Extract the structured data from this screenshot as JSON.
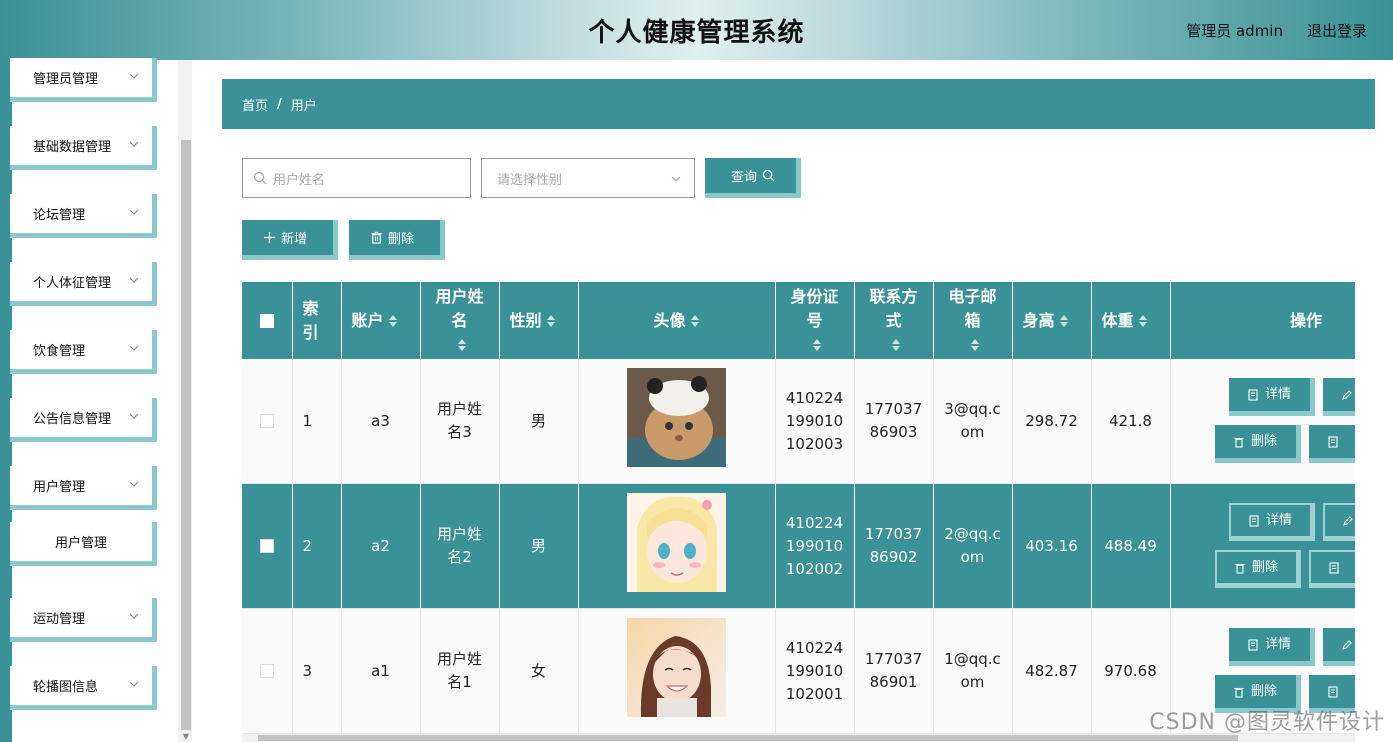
{
  "header": {
    "title": "个人健康管理系统",
    "user": "管理员 admin",
    "logout": "退出登录"
  },
  "sidebar": {
    "items": [
      {
        "label": "管理员管理"
      },
      {
        "label": "基础数据管理"
      },
      {
        "label": "论坛管理"
      },
      {
        "label": "个人体征管理"
      },
      {
        "label": "饮食管理"
      },
      {
        "label": "公告信息管理"
      },
      {
        "label": "用户管理"
      },
      {
        "label": "运动管理"
      },
      {
        "label": "轮播图信息"
      }
    ],
    "active_sub": "用户管理"
  },
  "breadcrumb": {
    "home": "首页",
    "sep": "/",
    "current": "用户"
  },
  "search": {
    "name_placeholder": "用户姓名",
    "gender_placeholder": "请选择性别",
    "query_label": "查询"
  },
  "actions": {
    "add_label": "新增",
    "delete_label": "删除"
  },
  "table": {
    "headers": {
      "index": "索引",
      "account": "账户",
      "name": "用户姓名",
      "gender": "性别",
      "avatar": "头像",
      "idcard": "身份证号",
      "phone": "联系方式",
      "email": "电子邮箱",
      "height": "身高",
      "weight": "体重",
      "ops": "操作"
    },
    "rows": [
      {
        "index": "1",
        "account": "a3",
        "name": "用户姓名3",
        "gender": "男",
        "idcard": "410224199010102003",
        "phone": "17703786903",
        "email": "3@qq.com",
        "height": "298.72",
        "weight": "421.8"
      },
      {
        "index": "2",
        "account": "a2",
        "name": "用户姓名2",
        "gender": "男",
        "idcard": "410224199010102002",
        "phone": "17703786902",
        "email": "2@qq.com",
        "height": "403.16",
        "weight": "488.49"
      },
      {
        "index": "3",
        "account": "a1",
        "name": "用户姓名1",
        "gender": "女",
        "idcard": "410224199010102001",
        "phone": "17703786901",
        "email": "1@qq.com",
        "height": "482.87",
        "weight": "970.68"
      }
    ],
    "op_detail": "详情",
    "op_delete": "删除"
  },
  "watermark": "CSDN @图灵软件设计",
  "colors": {
    "primary": "#3a9197",
    "accent": "#8ac8cd"
  }
}
